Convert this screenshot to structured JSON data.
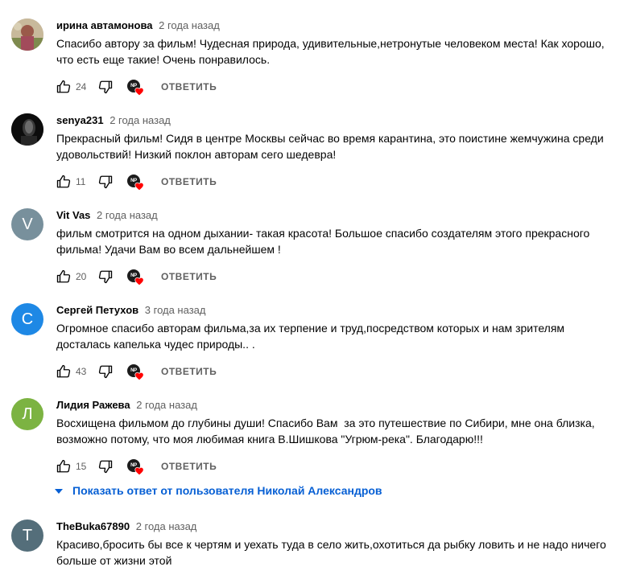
{
  "comments": [
    {
      "author": "ирина автамонова",
      "time": "2 года назад",
      "text_lines": [
        "Спасибо автору за фильм! Чудесная природа, удивительные,нетронутые человеком места! Как хорошо,",
        "что есть еще такие! Очень понравилось."
      ],
      "likes": "24",
      "reply_label": "ОТВЕТИТЬ",
      "avatar": {
        "type": "photo",
        "color": "#9c8f6c"
      }
    },
    {
      "author": "senya231",
      "time": "2 года назад",
      "text_lines": [
        "Прекрасный фильм! Сидя в центре Москвы сейчас во время карантина, это поистине жемчужина среди",
        "удовольствий! Низкий поклон авторам сего шедевра!"
      ],
      "likes": "11",
      "reply_label": "ОТВЕТИТЬ",
      "avatar": {
        "type": "photo",
        "color": "#111111"
      }
    },
    {
      "author": "Vit Vas",
      "time": "2 года назад",
      "text_lines": [
        "фильм смотрится на одном дыхании- такая красота! Большое спасибо создателям этого прекрасного",
        "фильма! Удачи Вам во всем дальнейшем !"
      ],
      "likes": "20",
      "reply_label": "ОТВЕТИТЬ",
      "avatar": {
        "type": "letter",
        "letter": "V",
        "color": "#78909c"
      }
    },
    {
      "author": "Сергей Петухов",
      "time": "3 года назад",
      "text_lines": [
        "Огромное спасибо авторам фильма,за их терпение и труд,посредством которых и нам зрителям",
        "досталась капелька чудес природы.. ."
      ],
      "likes": "43",
      "reply_label": "ОТВЕТИТЬ",
      "avatar": {
        "type": "letter",
        "letter": "С",
        "color": "#1e88e5"
      }
    },
    {
      "author": "Лидия Ражева",
      "time": "2 года назад",
      "text_lines": [
        "Восхищена фильмом до глубины души! Спасибо Вам  за это путешествие по Сибири, мне она близка,",
        "возможно потому, что моя любимая книга В.Шишкова \"Угрюм-река\". Благодарю!!!"
      ],
      "likes": "15",
      "reply_label": "ОТВЕТИТЬ",
      "avatar": {
        "type": "letter",
        "letter": "Л",
        "color": "#7cb342"
      }
    },
    {
      "author": "TheBuka67890",
      "time": "2 года назад",
      "text_lines": [
        "Красиво,бросить бы все к чертям и уехать туда в село жить,охотиться да рыбку ловить и не надо ничего",
        "больше от жизни этой"
      ],
      "avatar": {
        "type": "letter",
        "letter": "T",
        "color": "#546e7a"
      }
    }
  ],
  "show_replies_label": "Показать ответ от пользователя Николай Александров",
  "heart_avatar_text": "NP",
  "colors": {
    "link_blue": "#065fd4",
    "heart_red": "#ff0000",
    "secondary_text": "#606060"
  },
  "icons": {
    "like": "thumbs-up-icon",
    "dislike": "thumbs-down-icon",
    "creator_heart": "creator-heart-icon",
    "expand": "chevron-down-icon"
  }
}
